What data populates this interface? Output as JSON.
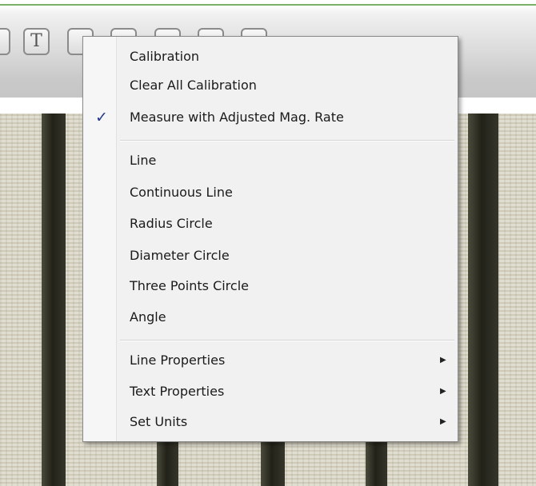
{
  "toolbar": {
    "text_tool_label": "T",
    "buttons": [
      "text-tool",
      "pen-tool",
      "arrow-left-tool",
      "arrow-right-tool",
      "circle-tool",
      "circle-tool-2"
    ]
  },
  "context_menu": {
    "check_glyph": "✓",
    "submenu_glyph": "▶",
    "items": [
      {
        "label": "Calibration"
      },
      {
        "label": "Clear All Calibration"
      },
      {
        "label": "Measure with Adjusted Mag. Rate",
        "checked": true
      },
      {
        "label": "Line"
      },
      {
        "label": "Continuous Line"
      },
      {
        "label": "Radius Circle"
      },
      {
        "label": "Diameter Circle"
      },
      {
        "label": "Three Points Circle"
      },
      {
        "label": "Angle"
      },
      {
        "label": "Line Properties",
        "submenu": true
      },
      {
        "label": "Text Properties",
        "submenu": true
      },
      {
        "label": "Set Units",
        "submenu": true
      }
    ]
  },
  "colors": {
    "accent_line": "#79b064",
    "check_mark": "#233a8c",
    "menu_background": "#f1f1f1"
  }
}
